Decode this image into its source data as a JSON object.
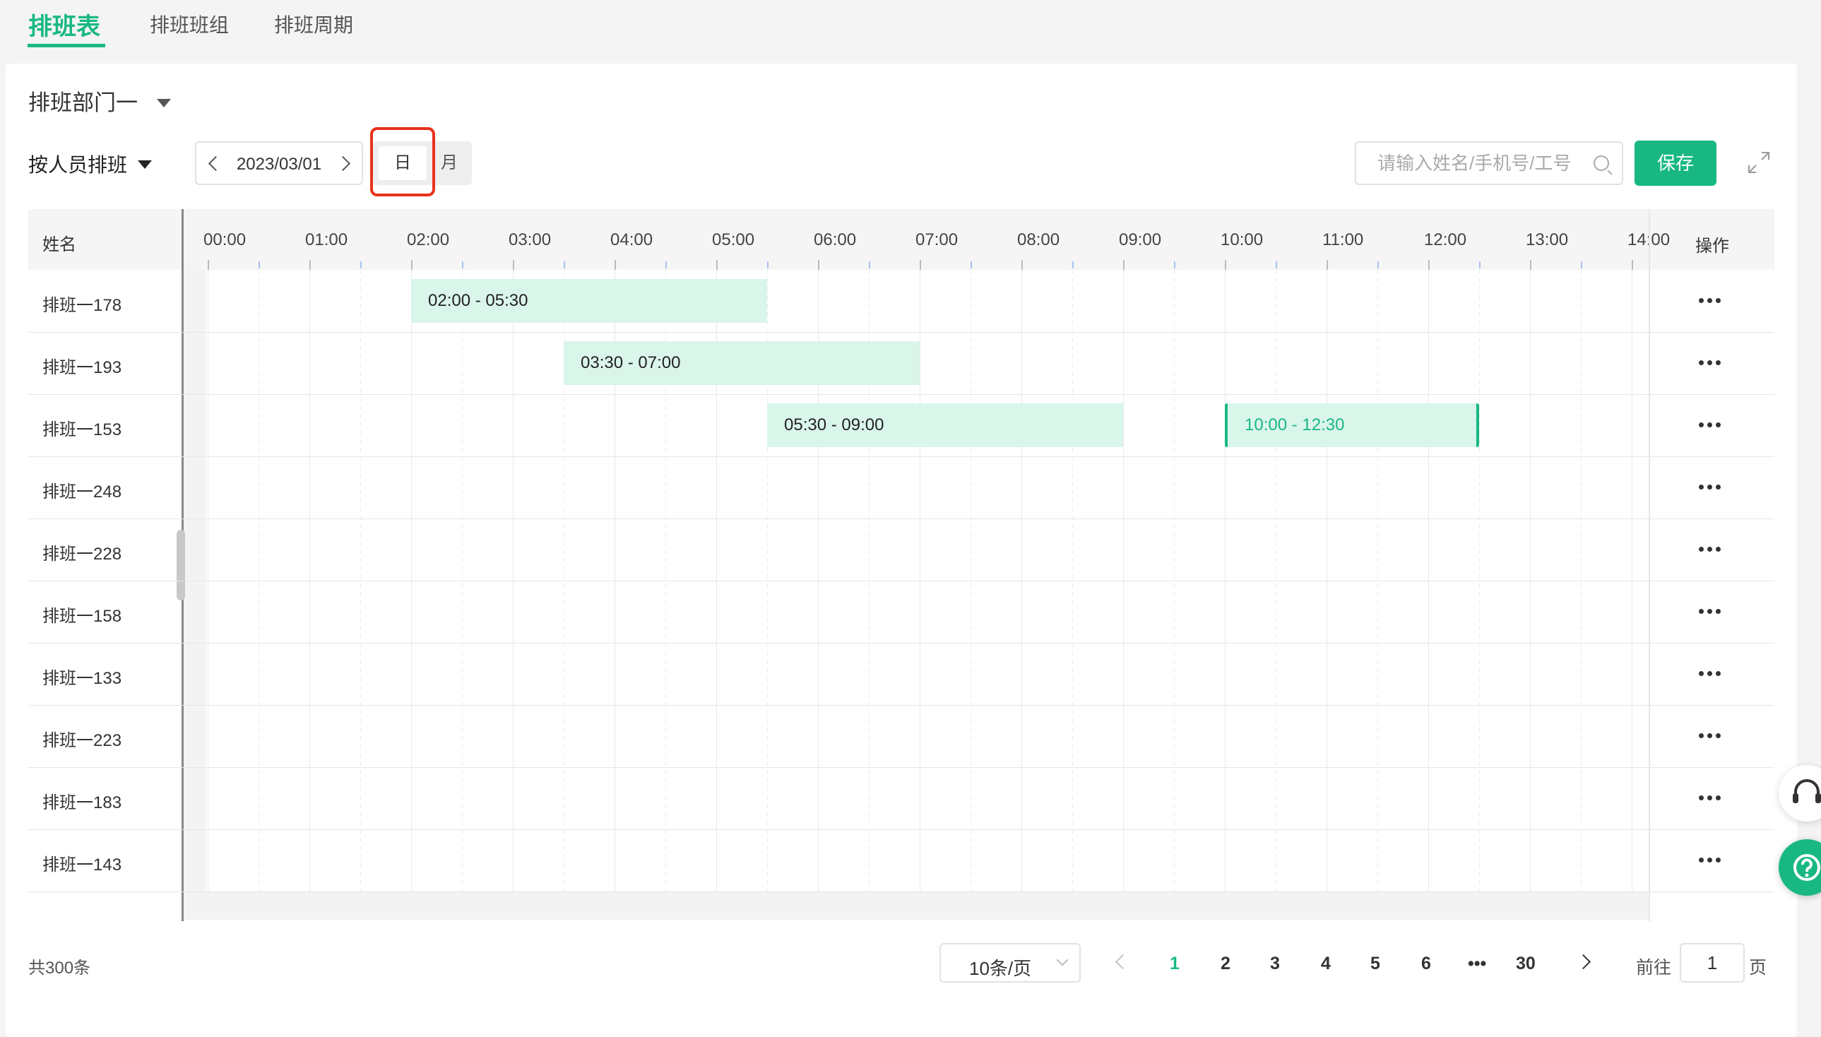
{
  "top_tabs": [
    {
      "label": "排班表",
      "active": true
    },
    {
      "label": "排班班组",
      "active": false
    },
    {
      "label": "排班周期",
      "active": false
    }
  ],
  "department": "排班部门一",
  "schedule_mode": "按人员排班",
  "date": "2023/03/01",
  "view_toggle": {
    "day": "日",
    "month": "月",
    "selected": "日"
  },
  "search": {
    "placeholder": "请输入姓名/手机号/工号",
    "value": ""
  },
  "save_label": "保存",
  "grid": {
    "name_header": "姓名",
    "ops_header": "操作",
    "hours": [
      "00:00",
      "01:00",
      "02:00",
      "03:00",
      "04:00",
      "05:00",
      "06:00",
      "07:00",
      "08:00",
      "09:00",
      "10:00",
      "11:00",
      "12:00",
      "13:00",
      "14:00"
    ],
    "rows": [
      {
        "name": "排班一178",
        "shifts": [
          {
            "label": "02:00 - 05:30",
            "start": 2.0,
            "end": 5.5,
            "active": false
          }
        ]
      },
      {
        "name": "排班一193",
        "shifts": [
          {
            "label": "03:30 - 07:00",
            "start": 3.5,
            "end": 7.0,
            "active": false
          }
        ]
      },
      {
        "name": "排班一153",
        "shifts": [
          {
            "label": "05:30 - 09:00",
            "start": 5.5,
            "end": 9.0,
            "active": false
          },
          {
            "label": "10:00 - 12:30",
            "start": 10.0,
            "end": 12.5,
            "active": true
          }
        ]
      },
      {
        "name": "排班一248",
        "shifts": []
      },
      {
        "name": "排班一228",
        "shifts": []
      },
      {
        "name": "排班一158",
        "shifts": []
      },
      {
        "name": "排班一133",
        "shifts": []
      },
      {
        "name": "排班一223",
        "shifts": []
      },
      {
        "name": "排班一183",
        "shifts": []
      },
      {
        "name": "排班一143",
        "shifts": []
      }
    ]
  },
  "pagination": {
    "total": "共300条",
    "page_size": "10条/页",
    "pages": [
      "1",
      "2",
      "3",
      "4",
      "5",
      "6",
      "•••",
      "30"
    ],
    "current": "1",
    "goto_label": "前往",
    "goto_value": "1",
    "goto_suffix": "页"
  },
  "colors": {
    "accent": "#19b883",
    "shift_bg": "#daf5ea",
    "highlight": "#e8321c"
  }
}
